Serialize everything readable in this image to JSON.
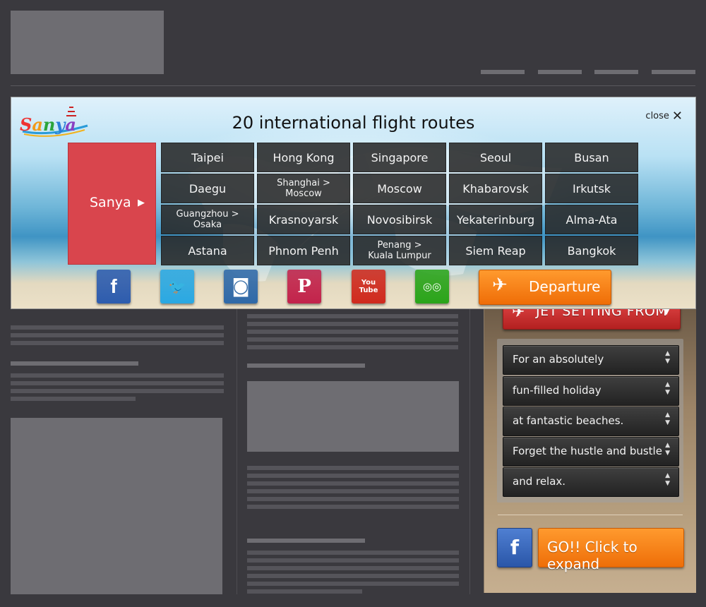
{
  "modal": {
    "title": "20 international flight routes",
    "close_label": "close",
    "logo_text": "Sanya",
    "origin_label": "Sanya",
    "routes": [
      {
        "label": "Taipei"
      },
      {
        "label": "Hong Kong"
      },
      {
        "label": "Singapore"
      },
      {
        "label": "Seoul"
      },
      {
        "label": "Busan"
      },
      {
        "label": "Daegu"
      },
      {
        "line1": "Shanghai >",
        "line2": "Moscow"
      },
      {
        "label": "Moscow"
      },
      {
        "label": "Khabarovsk"
      },
      {
        "label": "Irkutsk"
      },
      {
        "line1": "Guangzhou >",
        "line2": "Osaka"
      },
      {
        "label": "Krasnoyarsk"
      },
      {
        "label": "Novosibirsk"
      },
      {
        "label": "Yekaterinburg"
      },
      {
        "label": "Alma-Ata"
      },
      {
        "label": "Astana"
      },
      {
        "label": "Phnom Penh"
      },
      {
        "line1": "Penang >",
        "line2": "Kuala Lumpur"
      },
      {
        "label": "Siem Reap"
      },
      {
        "label": "Bangkok"
      }
    ],
    "social": [
      {
        "icon": "facebook-icon",
        "glyph": "f",
        "color": "#2d5cae"
      },
      {
        "icon": "twitter-icon",
        "glyph": "🐦",
        "color": "#2aa8e2"
      },
      {
        "icon": "instagram-icon",
        "glyph": "◙",
        "color": "#2f69a8"
      },
      {
        "icon": "pinterest-icon",
        "glyph": "P",
        "color": "#c2234b"
      },
      {
        "icon": "youtube-icon",
        "glyph": "You\nTube",
        "color": "#cf2a1e"
      },
      {
        "icon": "tripadvisor-icon",
        "glyph": "◎◎",
        "color": "#2aa41a"
      }
    ],
    "departure_label": "Departure"
  },
  "sidebar": {
    "jet_label": "JET SETTING FROM",
    "selects": [
      "For an absolutely",
      "fun-filled holiday",
      "at fantastic beaches.",
      "Forget the hustle and bustle",
      "and relax."
    ],
    "go_label": "GO!! Click to expand",
    "facebook_glyph": "f"
  }
}
